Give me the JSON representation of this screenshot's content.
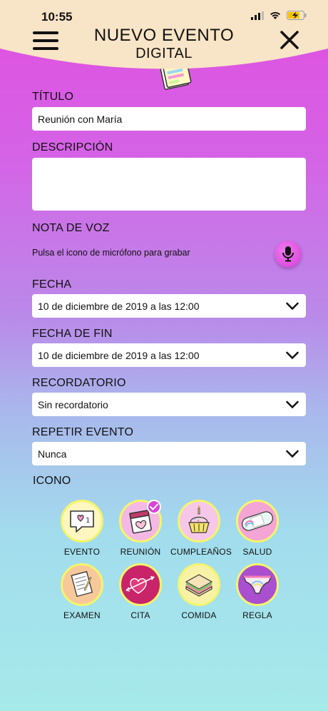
{
  "status_bar": {
    "time": "10:55"
  },
  "header": {
    "title_line1": "NUEVO EVENTO",
    "title_line2": "DIGITAL"
  },
  "form": {
    "titulo": {
      "label": "TÍTULO",
      "value": "Reunión con María"
    },
    "descripcion": {
      "label": "DESCRIPCIÓN",
      "value": ""
    },
    "nota_voz": {
      "label": "NOTA DE VOZ",
      "hint": "Pulsa el icono de micrófono para grabar"
    },
    "fecha": {
      "label": "FECHA",
      "value": "10 de diciembre de 2019 a las 12:00"
    },
    "fecha_fin": {
      "label": "FECHA DE FIN",
      "value": "10 de diciembre de 2019 a las 12:00"
    },
    "recordatorio": {
      "label": "RECORDATORIO",
      "value": "Sin recordatorio"
    },
    "repetir": {
      "label": "REPETIR EVENTO",
      "value": "Nunca"
    }
  },
  "icons": {
    "label": "ICONO",
    "items": [
      {
        "label": "EVENTO",
        "icon": "heart-speech-bubble-icon",
        "bg": "#fff6c0",
        "selected": false
      },
      {
        "label": "REUNIÓN",
        "icon": "calendar-heart-icon",
        "bg": "#f4b8e4",
        "selected": true
      },
      {
        "label": "CUMPLEAÑOS",
        "icon": "cupcake-icon",
        "bg": "#f7c7ea",
        "selected": false
      },
      {
        "label": "SALUD",
        "icon": "band-aid-icon",
        "bg": "#f3a5d5",
        "selected": false
      },
      {
        "label": "EXAMEN",
        "icon": "exam-paper-icon",
        "bg": "#f7c99a",
        "selected": false
      },
      {
        "label": "CITA",
        "icon": "heart-arrow-icon",
        "bg": "#c9246a",
        "selected": false
      },
      {
        "label": "COMIDA",
        "icon": "sandwich-icon",
        "bg": "#f8f2a8",
        "selected": false
      },
      {
        "label": "REGLA",
        "icon": "underwear-icon",
        "bg": "#a94fcf",
        "selected": false
      }
    ]
  },
  "colors": {
    "header_bg": "#f8e4c6",
    "accent": "#d844d8",
    "icon_border": "#f4f56a"
  }
}
